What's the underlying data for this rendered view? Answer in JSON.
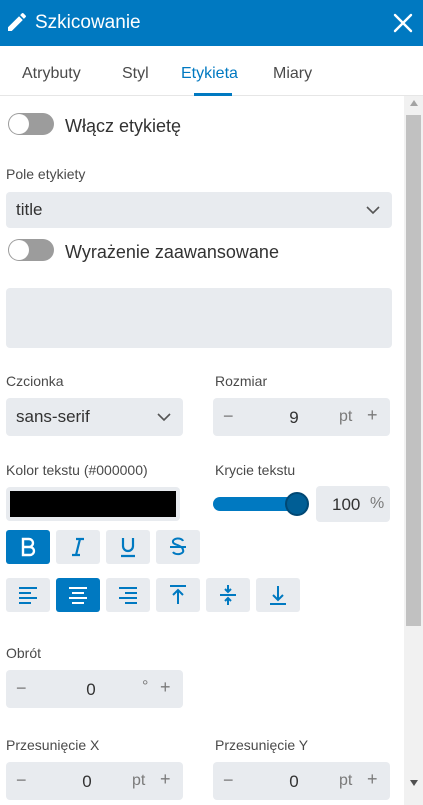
{
  "header": {
    "title": "Szkicowanie"
  },
  "tabs": [
    {
      "label": "Atrybuty",
      "active": false
    },
    {
      "label": "Styl",
      "active": false
    },
    {
      "label": "Etykieta",
      "active": true
    },
    {
      "label": "Miary",
      "active": false
    }
  ],
  "label_toggle": {
    "label": "Włącz etykietę",
    "on": false
  },
  "label_field": {
    "label": "Pole etykiety",
    "value": "title"
  },
  "advanced_toggle": {
    "label": "Wyrażenie zaawansowane",
    "on": false
  },
  "font": {
    "label": "Czcionka",
    "value": "sans-serif"
  },
  "size": {
    "label": "Rozmiar",
    "value": "9",
    "unit": "pt"
  },
  "text_color": {
    "label": "Kolor tekstu (#000000)",
    "color": "#000000"
  },
  "text_opacity": {
    "label": "Krycie tekstu",
    "value": "100",
    "unit": "%",
    "level": 1.0
  },
  "style_buttons": [
    {
      "name": "bold",
      "icon": "bold-icon",
      "active": true
    },
    {
      "name": "italic",
      "icon": "italic-icon",
      "active": false
    },
    {
      "name": "underline",
      "icon": "underline-icon",
      "active": false
    },
    {
      "name": "strikethrough",
      "icon": "strikethrough-icon",
      "active": false
    }
  ],
  "align_buttons": [
    {
      "name": "align-left",
      "icon": "align-left-icon",
      "active": false
    },
    {
      "name": "align-center",
      "icon": "align-center-icon",
      "active": true
    },
    {
      "name": "align-right",
      "icon": "align-right-icon",
      "active": false
    },
    {
      "name": "align-top",
      "icon": "align-top-icon",
      "active": false
    },
    {
      "name": "align-middle",
      "icon": "align-middle-icon",
      "active": false
    },
    {
      "name": "align-bottom",
      "icon": "align-bottom-icon",
      "active": false
    }
  ],
  "rotation": {
    "label": "Obrót",
    "value": "0",
    "unit": "°"
  },
  "offset_x": {
    "label": "Przesunięcie X",
    "value": "0",
    "unit": "pt"
  },
  "offset_y": {
    "label": "Przesunięcie Y",
    "value": "0",
    "unit": "pt"
  },
  "stepper_symbols": {
    "minus": "−",
    "plus": "+"
  },
  "colors": {
    "accent": "#0079c1",
    "active_tab": "#0079c1",
    "field_bg": "#e8ebef",
    "toggle_off": "#9c9c9c"
  }
}
